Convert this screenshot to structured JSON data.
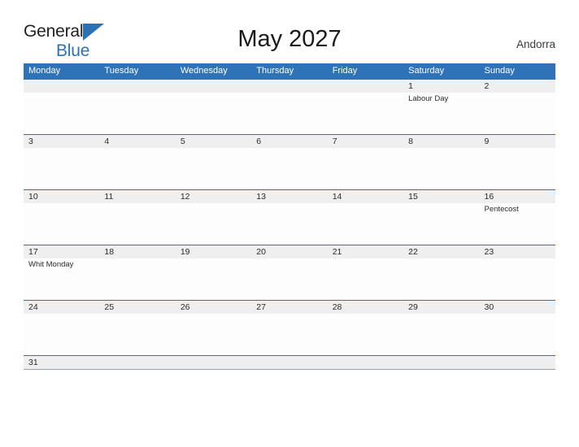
{
  "brand": {
    "line1": "General",
    "line2": "Blue",
    "triangle_icon": "blue-triangle-icon",
    "color_dark": "#231f20",
    "color_blue": "#2b72b5"
  },
  "header": {
    "title": "May 2027",
    "country": "Andorra"
  },
  "colors": {
    "header_blue": "#2e72b8",
    "row_band_gray": "#efefef",
    "text": "#2b2b2b",
    "page_background": "#ffffff"
  },
  "calendar": {
    "weekdays": [
      "Monday",
      "Tuesday",
      "Wednesday",
      "Thursday",
      "Friday",
      "Saturday",
      "Sunday"
    ],
    "weeks": [
      {
        "days": [
          {
            "num": "",
            "event": ""
          },
          {
            "num": "",
            "event": ""
          },
          {
            "num": "",
            "event": ""
          },
          {
            "num": "",
            "event": ""
          },
          {
            "num": "",
            "event": ""
          },
          {
            "num": "1",
            "event": "Labour Day"
          },
          {
            "num": "2",
            "event": ""
          }
        ]
      },
      {
        "days": [
          {
            "num": "3",
            "event": ""
          },
          {
            "num": "4",
            "event": ""
          },
          {
            "num": "5",
            "event": ""
          },
          {
            "num": "6",
            "event": ""
          },
          {
            "num": "7",
            "event": ""
          },
          {
            "num": "8",
            "event": ""
          },
          {
            "num": "9",
            "event": ""
          }
        ]
      },
      {
        "days": [
          {
            "num": "10",
            "event": ""
          },
          {
            "num": "11",
            "event": ""
          },
          {
            "num": "12",
            "event": ""
          },
          {
            "num": "13",
            "event": ""
          },
          {
            "num": "14",
            "event": ""
          },
          {
            "num": "15",
            "event": ""
          },
          {
            "num": "16",
            "event": "Pentecost"
          }
        ]
      },
      {
        "days": [
          {
            "num": "17",
            "event": "Whit Monday"
          },
          {
            "num": "18",
            "event": ""
          },
          {
            "num": "19",
            "event": ""
          },
          {
            "num": "20",
            "event": ""
          },
          {
            "num": "21",
            "event": ""
          },
          {
            "num": "22",
            "event": ""
          },
          {
            "num": "23",
            "event": ""
          }
        ]
      },
      {
        "days": [
          {
            "num": "24",
            "event": ""
          },
          {
            "num": "25",
            "event": ""
          },
          {
            "num": "26",
            "event": ""
          },
          {
            "num": "27",
            "event": ""
          },
          {
            "num": "28",
            "event": ""
          },
          {
            "num": "29",
            "event": ""
          },
          {
            "num": "30",
            "event": ""
          }
        ]
      },
      {
        "days": [
          {
            "num": "31",
            "event": ""
          },
          {
            "num": "",
            "event": ""
          },
          {
            "num": "",
            "event": ""
          },
          {
            "num": "",
            "event": ""
          },
          {
            "num": "",
            "event": ""
          },
          {
            "num": "",
            "event": ""
          },
          {
            "num": "",
            "event": ""
          }
        ]
      }
    ]
  }
}
